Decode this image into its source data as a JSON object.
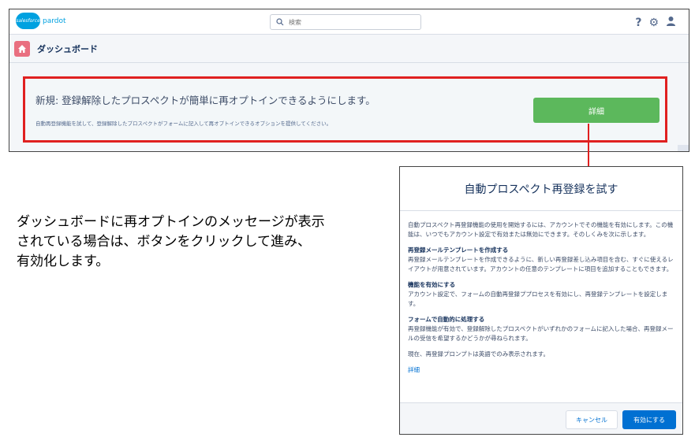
{
  "brand": {
    "logo_small_text": "salesforce",
    "product_name": "pardot"
  },
  "search": {
    "placeholder": "検索"
  },
  "top_icons": {
    "help": "?",
    "settings": "⚙",
    "user": "👤"
  },
  "dashboard": {
    "title": "ダッシュボード"
  },
  "notice": {
    "title": "新規: 登録解除したプロスペクトが簡単に再オプトインできるようにします。",
    "description": "自動再登録機能を試して、登録解除したプロスペクトがフォームに記入して再オプトインできるオプションを提供してください。",
    "button_label": "詳細"
  },
  "caption": {
    "lines": [
      "ダッシュボードに再オプトインのメッセージが表示",
      "されている場合は、ボタンをクリックして進み、",
      "有効化します。"
    ]
  },
  "modal": {
    "title": "自動プロスペクト再登録を試す",
    "intro": "自動プロスペクト再登録機能の使用を開始するには、アカウントでその機能を有効にします。この機能は、いつでもアカウント設定で有効または無効にできます。そのしくみを次に示します。",
    "sections": [
      {
        "heading": "再登録メールテンプレートを作成する",
        "body": "再登録メールテンプレートを作成できるように、新しい再登録差し込み項目を含む、すぐに使えるレイアウトが用意されています。アカウントの任意のテンプレートに項目を追加することもできます。"
      },
      {
        "heading": "機能を有効にする",
        "body": "アカウント設定で、フォームの自動再登録ププロセスを有効にし、再登録テンプレートを設定します。"
      },
      {
        "heading": "フォームで自動的に処理する",
        "body": "再登録機能が有効で、登録解除したプロスペクトがいずれかのフォームに記入した場合、再登録メールの受信を希望するかどうかが尋ねられます。"
      }
    ],
    "note": "現在、再登録プロンプトは英語でのみ表示されます。",
    "link_label": "詳細",
    "cancel_label": "キャンセル",
    "enable_label": "有効にする"
  },
  "colors": {
    "highlight_red": "#e02020",
    "detail_button_green": "#5cb85c",
    "primary_blue": "#0070d2",
    "home_icon_pink": "#e96f80"
  }
}
